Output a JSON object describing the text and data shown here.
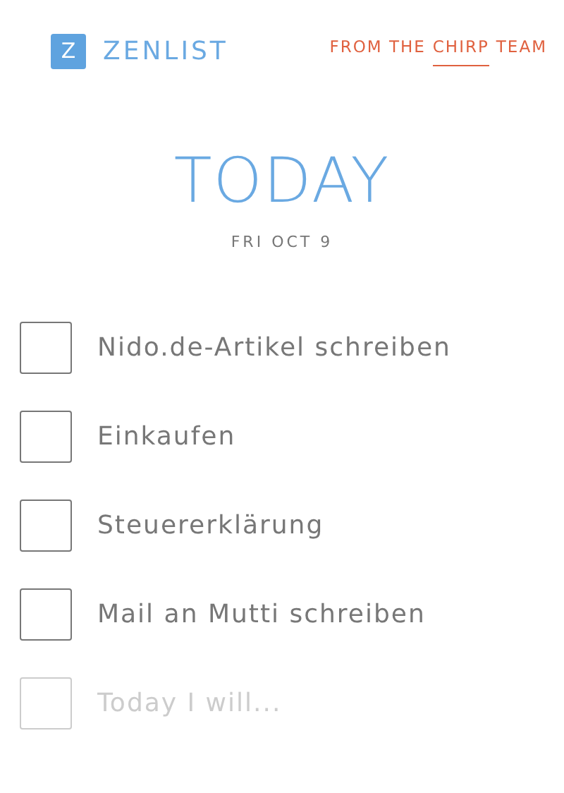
{
  "header": {
    "logo_letter": "Z",
    "app_name": "ZENLIST",
    "credit": {
      "before": "FROM THE",
      "link": "CHIRP",
      "after": "TEAM"
    }
  },
  "heading": {
    "title": "TODAY",
    "date": "FRI OCT 9"
  },
  "tasks": [
    {
      "label": "Nido.de-Artikel schreiben",
      "checked": false
    },
    {
      "label": "Einkaufen",
      "checked": false
    },
    {
      "label": "Steuererklärung",
      "checked": false
    },
    {
      "label": "Mail an Mutti schreiben",
      "checked": false
    }
  ],
  "new_task": {
    "placeholder": "Today I will...",
    "checkbox_disabled": true
  }
}
